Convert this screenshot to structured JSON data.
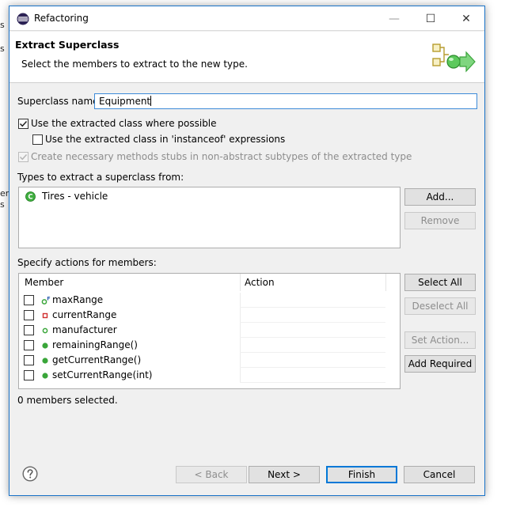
{
  "background": {
    "fragments": [
      "s",
      "s",
      "en",
      "s"
    ]
  },
  "window": {
    "title": "Refactoring",
    "controls": {
      "minimize": "—",
      "maximize": "☐",
      "close": "✕"
    }
  },
  "header": {
    "title": "Extract Superclass",
    "description": "Select the members to extract to the new type."
  },
  "form": {
    "superclass_label": "Superclass name:",
    "superclass_value": "Equipment",
    "checkboxes": [
      {
        "label": "Use the extracted class where possible",
        "checked": true,
        "enabled": true
      },
      {
        "label": "Use the extracted class in 'instanceof' expressions",
        "checked": false,
        "enabled": true
      },
      {
        "label": "Create necessary methods stubs in non-abstract subtypes of the extracted type",
        "checked": true,
        "enabled": false
      }
    ],
    "types_label": "Types to extract a superclass from:",
    "types": [
      {
        "name": "Tires - vehicle",
        "icon": "class-icon"
      }
    ],
    "types_buttons": {
      "add": "Add...",
      "remove": "Remove"
    },
    "actions_label": "Specify actions for members:",
    "columns": [
      "Member",
      "Action"
    ],
    "members": [
      {
        "name": "maxRange",
        "icon": "final-field-icon",
        "checked": false
      },
      {
        "name": "currentRange",
        "icon": "private-field-icon",
        "checked": false
      },
      {
        "name": "manufacturer",
        "icon": "field-icon",
        "checked": false
      },
      {
        "name": "remainingRange()",
        "icon": "public-method-icon",
        "checked": false
      },
      {
        "name": "getCurrentRange()",
        "icon": "public-method-icon",
        "checked": false
      },
      {
        "name": "setCurrentRange(int)",
        "icon": "public-method-icon",
        "checked": false
      }
    ],
    "member_buttons": {
      "select_all": "Select All",
      "deselect_all": "Deselect All",
      "set_action": "Set Action...",
      "add_required": "Add Required"
    },
    "status": "0 members selected."
  },
  "footer": {
    "help_icon": "help-icon",
    "back": "< Back",
    "next": "Next >",
    "finish": "Finish",
    "cancel": "Cancel"
  },
  "colors": {
    "accent": "#0078d7",
    "method_green": "#3aa63a",
    "private_red": "#d02f2f",
    "dialog_bg": "#f0f0f0"
  }
}
